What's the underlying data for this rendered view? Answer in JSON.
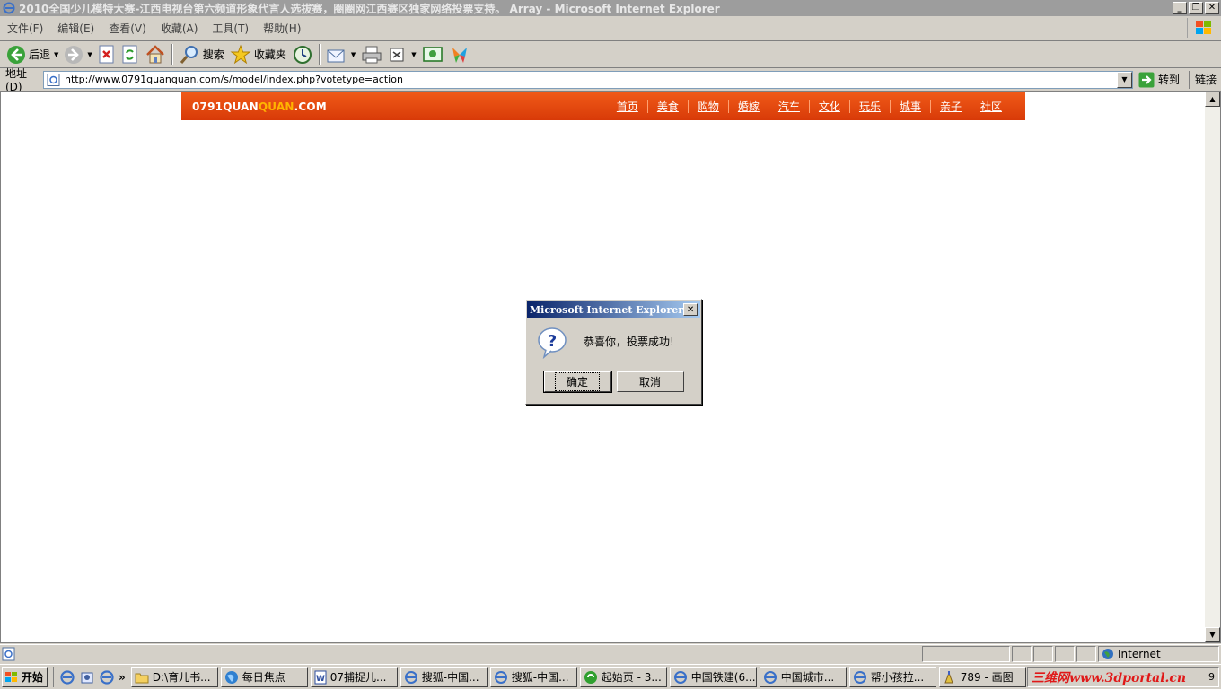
{
  "window": {
    "title": "2010全国少儿模特大赛-江西电视台第六频道形象代言人选拔赛，圈圈网江西赛区独家网络投票支持。 Array - Microsoft Internet Explorer"
  },
  "menu": [
    "文件(F)",
    "编辑(E)",
    "查看(V)",
    "收藏(A)",
    "工具(T)",
    "帮助(H)"
  ],
  "toolbar": {
    "back": "后退",
    "search": "搜索",
    "favorites": "收藏夹"
  },
  "address": {
    "label": "地址(D)",
    "url": "http://www.0791quanquan.com/s/model/index.php?votetype=action",
    "go": "转到",
    "links": "链接"
  },
  "site": {
    "logo_main": "0791QUAN",
    "logo_accent": "QUAN",
    "logo_tail": ".COM",
    "nav": [
      "首页",
      "美食",
      "购物",
      "婚嫁",
      "汽车",
      "文化",
      "玩乐",
      "城事",
      "亲子",
      "社区"
    ]
  },
  "dialog": {
    "title": "Microsoft Internet Explorer",
    "message": "恭喜你，投票成功!",
    "ok": "确定",
    "cancel": "取消"
  },
  "status": {
    "zone": "Internet"
  },
  "taskbar": {
    "start": "开始",
    "tasks": [
      {
        "label": "D:\\育儿书...",
        "icon": "folder-icon"
      },
      {
        "label": "每日焦点",
        "icon": "globe-icon"
      },
      {
        "label": "07捕捉儿...",
        "icon": "word-doc-icon"
      },
      {
        "label": "搜狐-中国...",
        "icon": "ie-icon"
      },
      {
        "label": "搜狐-中国...",
        "icon": "ie-icon"
      },
      {
        "label": "起始页 - 3...",
        "icon": "browser-icon"
      },
      {
        "label": "中国铁建(6...",
        "icon": "ie-icon"
      },
      {
        "label": "中国城市...",
        "icon": "ie-icon"
      },
      {
        "label": "帮小孩拉...",
        "icon": "ie-icon"
      },
      {
        "label": "789 - 画图",
        "icon": "paint-icon"
      }
    ],
    "watermark": "三维网www.3dportal.cn",
    "clock": "9"
  },
  "colors": {
    "site_header": "#e84a10",
    "logo_accent": "#ffb400",
    "dialog_title_start": "#0a246a",
    "dialog_title_end": "#a6caf0"
  }
}
